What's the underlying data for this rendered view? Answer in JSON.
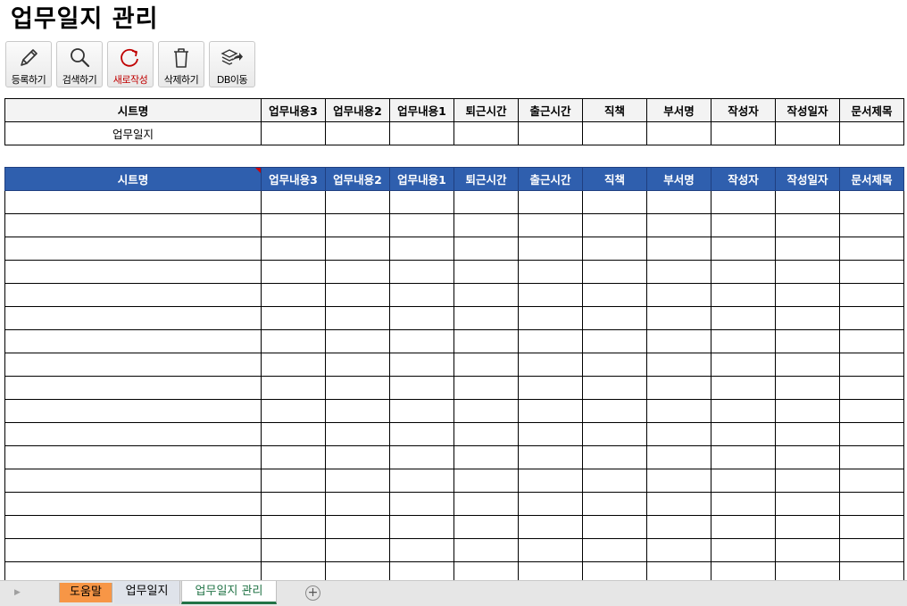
{
  "page": {
    "title": "업무일지 관리"
  },
  "toolbar": {
    "buttons": [
      {
        "label": "등록하기",
        "icon": "pencil-icon"
      },
      {
        "label": "검색하기",
        "icon": "magnifier-icon"
      },
      {
        "label": "새로작성",
        "icon": "refresh-icon"
      },
      {
        "label": "삭제하기",
        "icon": "trash-icon"
      },
      {
        "label": "DB이동",
        "icon": "layers-arrow-icon"
      }
    ]
  },
  "columns": [
    "시트명",
    "업무내용3",
    "업무내용2",
    "업무내용1",
    "퇴근시간",
    "출근시간",
    "직책",
    "부서명",
    "작성자",
    "작성일자",
    "문서제목"
  ],
  "search": {
    "sheet_value": "업무일지"
  },
  "sheet_tabs": {
    "help": "도움말",
    "diary": "업무일지",
    "manage": "업무일지 관리",
    "add": "⊕"
  },
  "colors": {
    "header_blue": "#2f5fae",
    "help_tab": "#f79646",
    "active_tab": "#217346"
  }
}
